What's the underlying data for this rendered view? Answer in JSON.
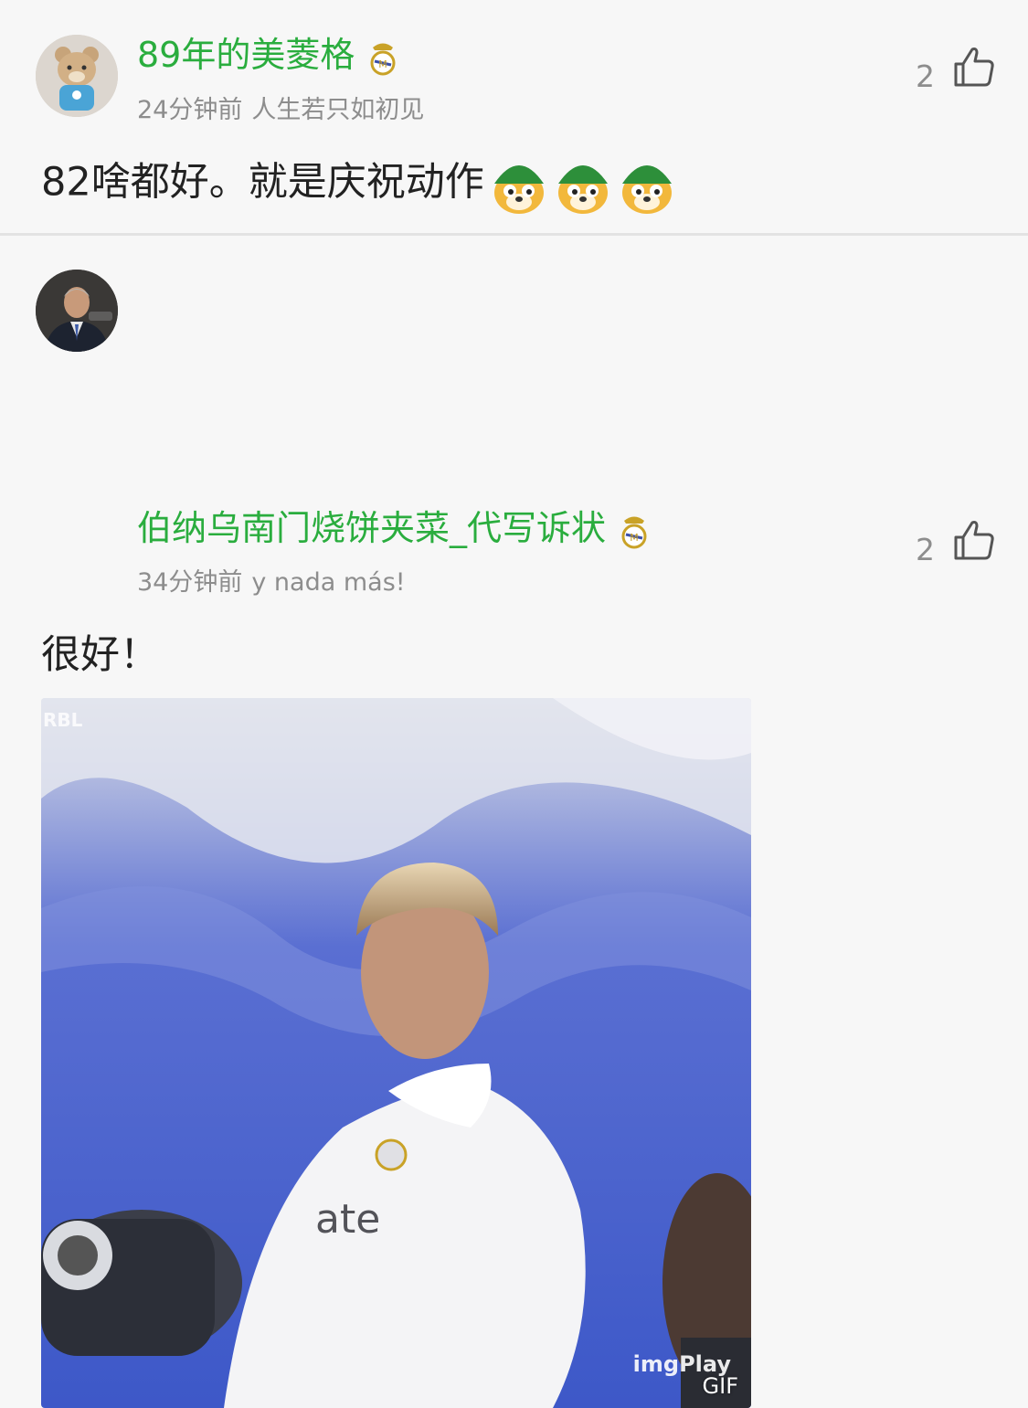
{
  "comments": [
    {
      "username": "89年的美菱格",
      "time": "24分钟前",
      "signature": "人生若只如初见",
      "likes": "2",
      "text": "82啥都好。就是庆祝动作",
      "emoji_count": 3,
      "avatar_icon": "bear-avatar-icon",
      "badge_icon": "real-madrid-badge-icon"
    },
    {
      "username": "伯纳乌南门烧饼夹菜_代写诉状",
      "time": "34分钟前",
      "signature": "y nada más!",
      "likes": "2",
      "text": "很好！",
      "avatar_icon": "man-in-suit-avatar-icon",
      "badge_icon": "real-madrid-badge-icon",
      "gif": {
        "corner_label": "RBL",
        "watermark": "imgPlay",
        "tag": "GIF"
      }
    }
  ],
  "colors": {
    "username": "#2aad3e",
    "meta": "#8d8d8d",
    "text": "#222222",
    "background": "#f7f7f7"
  }
}
